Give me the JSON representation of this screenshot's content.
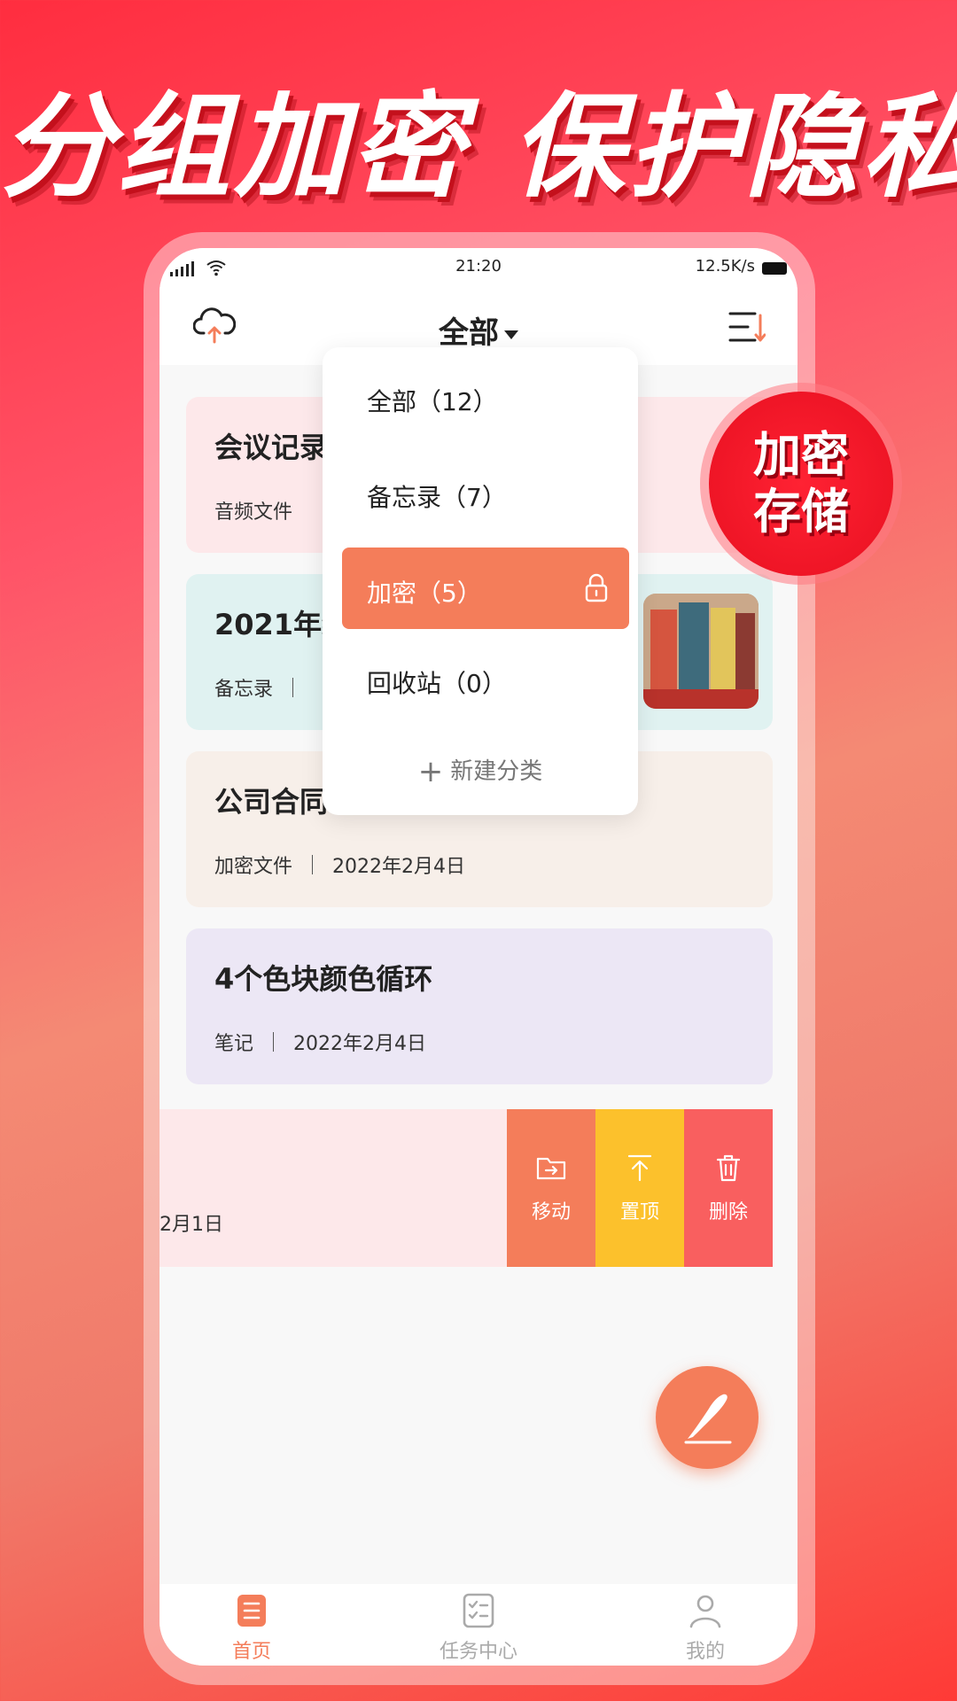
{
  "headline": "分组加密  保护隐私",
  "badge": {
    "line1": "加密",
    "line2": "存储"
  },
  "status_bar": {
    "time": "21:20",
    "speed": "12.5K/s"
  },
  "header": {
    "title": "全部"
  },
  "notes": [
    {
      "title": "会议记录",
      "meta_left": "音频文件",
      "meta_right": "",
      "bg": "#fde8ea"
    },
    {
      "title": "2021年终",
      "meta_left": "备忘录",
      "meta_right": "",
      "bg": "#e0f2f1"
    },
    {
      "title": "公司合同",
      "meta_left": "加密文件",
      "meta_right": "2022年2月4日",
      "bg": "#f7efe9"
    },
    {
      "title": "4个色块颜色循环",
      "meta_left": "笔记",
      "meta_right": "2022年2月4日",
      "bg": "#ece7f5"
    }
  ],
  "swipe_row": {
    "date_fragment": "2月1日",
    "actions": [
      {
        "label": "移动",
        "icon": "folder-move-icon",
        "color": "#f47d5a"
      },
      {
        "label": "置顶",
        "icon": "pin-top-icon",
        "color": "#fcc12c"
      },
      {
        "label": "删除",
        "icon": "trash-icon",
        "color": "#f95f5f"
      }
    ]
  },
  "dropdown": {
    "items": [
      {
        "label": "全部（12）"
      },
      {
        "label": "备忘录（7）"
      },
      {
        "label": "加密（5）",
        "active": true
      },
      {
        "label": "回收站（0）"
      }
    ],
    "new_label": "新建分类"
  },
  "bottom_nav": [
    {
      "label": "首页",
      "active": true
    },
    {
      "label": "任务中心"
    },
    {
      "label": "我的"
    }
  ],
  "colors": {
    "accent": "#f47d5a",
    "pin": "#fcc12c",
    "delete": "#f95f5f"
  }
}
